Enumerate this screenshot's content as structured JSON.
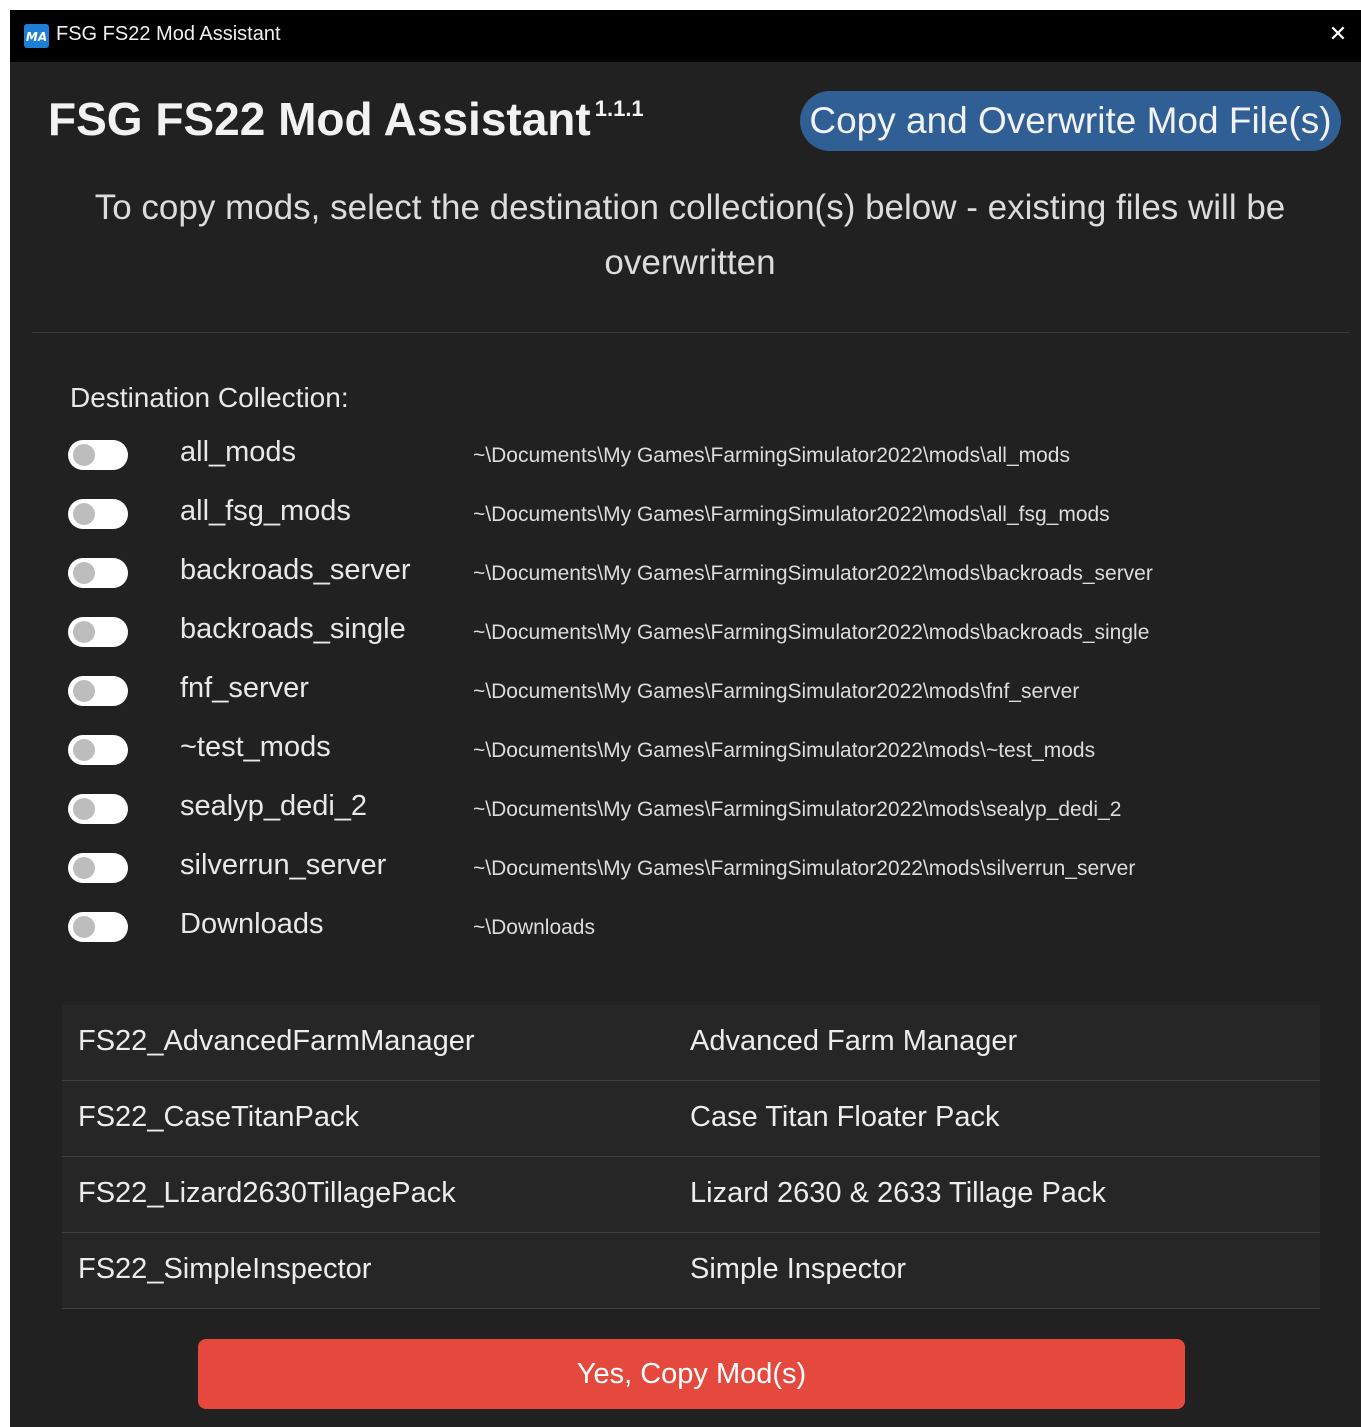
{
  "window": {
    "title": "FSG FS22 Mod Assistant",
    "icon_name": "app-logo-icon",
    "icon_text": "MA",
    "close_glyph": "✕"
  },
  "header": {
    "app_name": "FSG FS22 Mod Assistant",
    "version": "1.1.1",
    "action_title": "Copy and Overwrite Mod File(s)"
  },
  "instructions": "To copy mods, select the destination collection(s) below - existing files will be overwritten",
  "destination": {
    "label": "Destination Collection:",
    "collections": [
      {
        "name": "all_mods",
        "path": "~\\Documents\\My Games\\FarmingSimulator2022\\mods\\all_mods",
        "checked": false
      },
      {
        "name": "all_fsg_mods",
        "path": "~\\Documents\\My Games\\FarmingSimulator2022\\mods\\all_fsg_mods",
        "checked": false
      },
      {
        "name": "backroads_server",
        "path": "~\\Documents\\My Games\\FarmingSimulator2022\\mods\\backroads_server",
        "checked": false
      },
      {
        "name": "backroads_single",
        "path": "~\\Documents\\My Games\\FarmingSimulator2022\\mods\\backroads_single",
        "checked": false
      },
      {
        "name": "fnf_server",
        "path": "~\\Documents\\My Games\\FarmingSimulator2022\\mods\\fnf_server",
        "checked": false
      },
      {
        "name": "~test_mods",
        "path": "~\\Documents\\My Games\\FarmingSimulator2022\\mods\\~test_mods",
        "checked": false
      },
      {
        "name": "sealyp_dedi_2",
        "path": "~\\Documents\\My Games\\FarmingSimulator2022\\mods\\sealyp_dedi_2",
        "checked": false
      },
      {
        "name": "silverrun_server",
        "path": "~\\Documents\\My Games\\FarmingSimulator2022\\mods\\silverrun_server",
        "checked": false
      },
      {
        "name": "Downloads",
        "path": "~\\Downloads",
        "checked": false
      }
    ]
  },
  "mods": [
    {
      "file": "FS22_AdvancedFarmManager",
      "title": "Advanced Farm Manager"
    },
    {
      "file": "FS22_CaseTitanPack",
      "title": "Case Titan Floater Pack"
    },
    {
      "file": "FS22_Lizard2630TillagePack",
      "title": "Lizard 2630 & 2633 Tillage Pack"
    },
    {
      "file": "FS22_SimpleInspector",
      "title": "Simple Inspector"
    }
  ],
  "confirm_button": "Yes, Copy Mod(s)",
  "colors": {
    "window_bg": "#212121",
    "titlebar_bg": "#000000",
    "badge_bg": "#2f5f94",
    "confirm_bg": "#e5493d",
    "app_icon_bg": "#1f7fd6"
  }
}
